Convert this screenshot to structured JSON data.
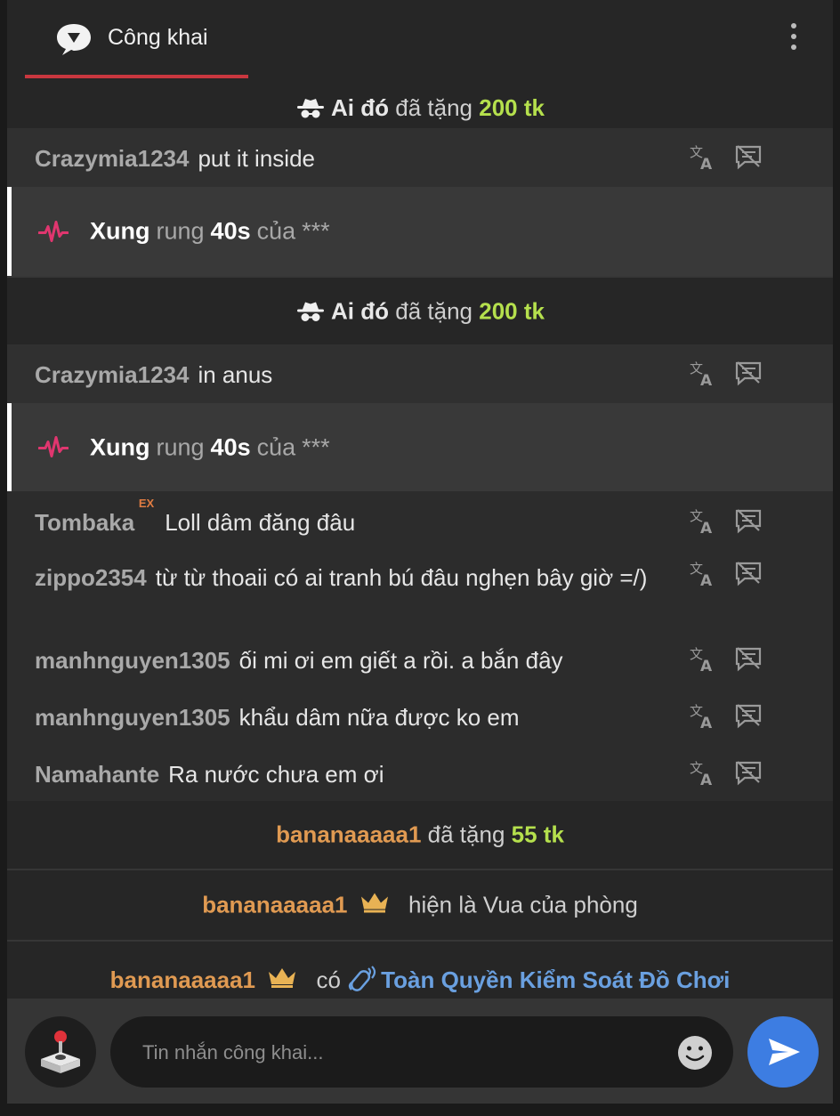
{
  "header": {
    "tab_label": "Công khai",
    "tab_icon": "chat-bubble-icon",
    "more_icon": "more-vertical-icon",
    "accent_color": "#c9373f"
  },
  "messages": {
    "gift1": {
      "who": "Ai đó",
      "verb": "đã tặng",
      "amount": "200 tk",
      "icon": "incognito-icon"
    },
    "chat1": {
      "user": "Crazymia1234",
      "text": "put it inside"
    },
    "vib1": {
      "who": "Xung",
      "verb": "rung",
      "duration": "40s",
      "of": "của",
      "target": "***",
      "icon": "pulse-icon"
    },
    "gift2": {
      "who": "Ai đó",
      "verb": "đã tặng",
      "amount": "200 tk",
      "icon": "incognito-icon"
    },
    "chat2": {
      "user": "Crazymia1234",
      "text": "in anus"
    },
    "vib2": {
      "who": "Xung",
      "verb": "rung",
      "duration": "40s",
      "of": "của",
      "target": "***",
      "icon": "pulse-icon"
    },
    "chat3": {
      "user": "Tombaka",
      "badge": "EX",
      "text": "Loll dâm đăng đâu"
    },
    "chat4": {
      "user": "zippo2354",
      "text": "từ từ thoaii có ai tranh bú đâu nghẹn bây giờ =/)"
    },
    "chat5": {
      "user": "manhnguyen1305",
      "text": "ối mi ơi em giết a rồi. a bắn đây"
    },
    "chat6": {
      "user": "manhnguyen1305",
      "text": "khẩu dâm nữa được ko em"
    },
    "chat7": {
      "user": "Namahante",
      "text": "Ra nước chưa em ơi"
    },
    "gift3": {
      "who": "bananaaaaa1",
      "verb": "đã tặng",
      "amount": "55 tk"
    },
    "king": {
      "who": "bananaaaaa1",
      "text": "hiện là Vua của phòng",
      "icon": "crown-icon"
    },
    "control": {
      "who": "bananaaaaa1",
      "verb": "có",
      "privilege": "Toàn Quyền Kiểm Soát Đồ Chơi",
      "icon": "crown-icon",
      "privilege_icon": "vibrating-toy-icon"
    }
  },
  "actions": {
    "translate_icon": "translate-icon",
    "hide_icon": "hide-message-icon"
  },
  "input": {
    "placeholder": "Tin nhắn công khai...",
    "left_button_icon": "joystick-icon",
    "emoji_icon": "smiley-icon",
    "send_icon": "send-icon",
    "send_color": "#3d7de2"
  },
  "colors": {
    "gift_amount": "#b5e04d",
    "gifter_name": "#e09a52",
    "privilege": "#6aa0e0"
  }
}
